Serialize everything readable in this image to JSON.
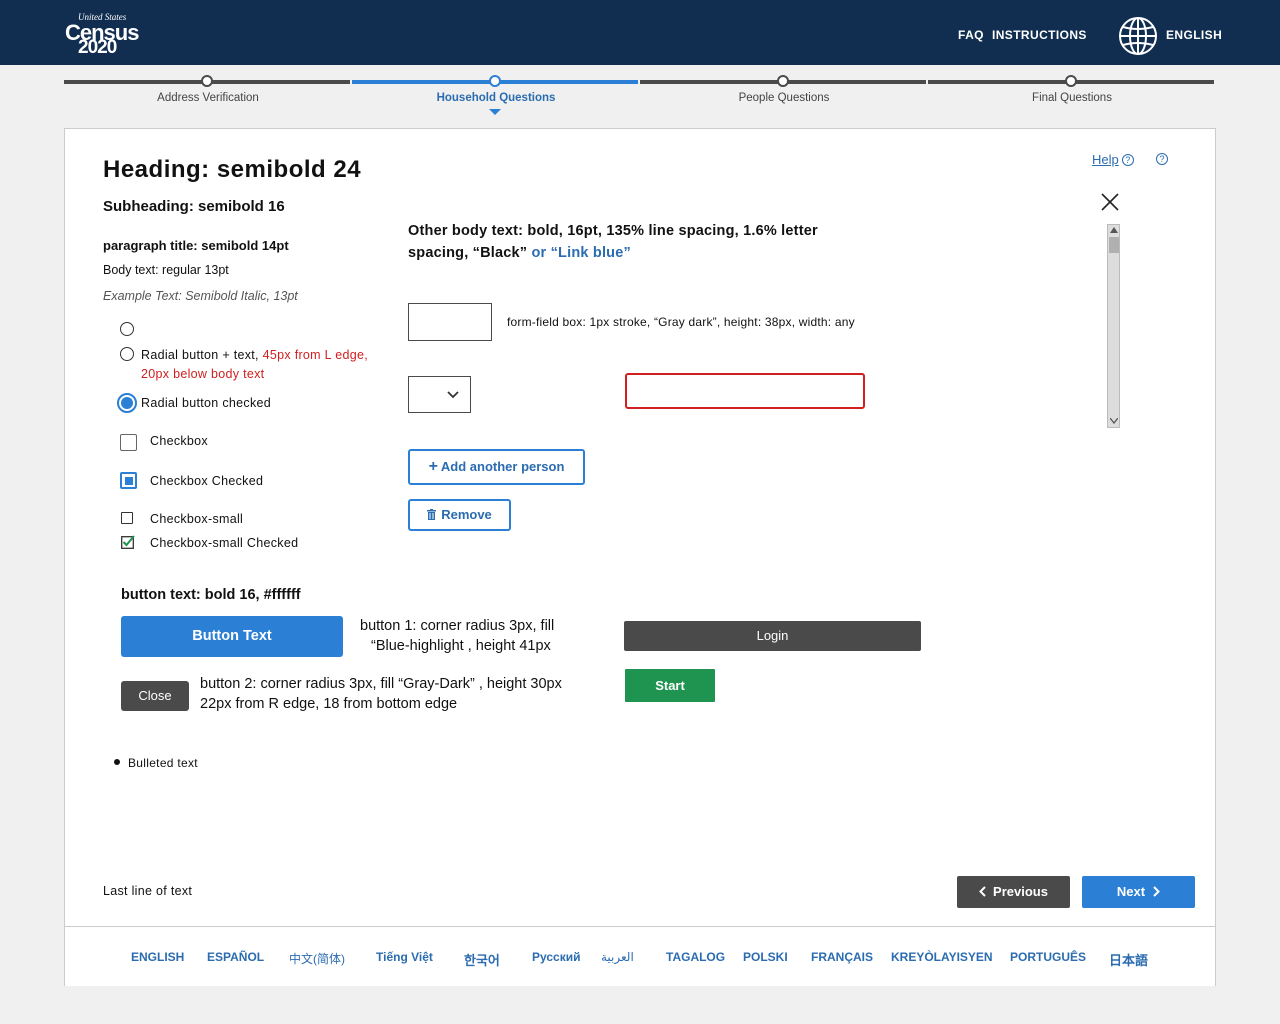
{
  "header": {
    "logo": {
      "line1": "United States",
      "line2": "Census",
      "line3": "2020"
    },
    "faq": "FAQ",
    "instructions": "INSTRUCTIONS",
    "language": "ENGLISH"
  },
  "progress": {
    "steps": [
      {
        "label": "Address Verification"
      },
      {
        "label": "Household Questions"
      },
      {
        "label": "People  Questions"
      },
      {
        "label": "Final Questions"
      }
    ],
    "active_index": 1
  },
  "content": {
    "heading": "Heading: semibold 24",
    "subheading": "Subheading: semibold 16",
    "paragraph_title": "paragraph title: semibold 14pt",
    "body_text": "Body text: regular 13pt",
    "example_text": "Example Text: Semibold Italic, 13pt",
    "help": "Help",
    "radio_label_a": "Radial button + text, ",
    "radio_label_red1": "45px from L edge,",
    "radio_label_red2": "20px below body text",
    "radio_checked_label": "Radial button checked",
    "checkbox_label": "Checkbox",
    "checkbox_checked_label": "Checkbox Checked",
    "checkbox_small_label": "Checkbox-small",
    "checkbox_small_checked_label": "Checkbox-small Checked",
    "other_body_black": "Other body text: bold, 16pt, 135% line spacing, 1.6% letter spacing, “Black”",
    "other_body_link": " or “Link blue”",
    "form_field_desc": "form-field box: 1px stroke, “Gray dark”, height: 38px, width: any",
    "add_person": "Add another person",
    "remove": "Remove",
    "button_text_title": "button text: bold 16, #ffffff",
    "button_text": "Button Text",
    "button1_desc_line1": "button 1: corner radius 3px, fill",
    "button1_desc_line2": "“Blue-highlight , height 41px",
    "close": "Close",
    "button2_desc_line1": "button 2: corner radius 3px, fill “Gray-Dark” , height 30px",
    "button2_desc_line2": "22px from R edge, 18 from bottom edge",
    "login": "Login",
    "start": "Start",
    "bulleted": "Bulleted text",
    "last_line": "Last line of text",
    "previous": "Previous",
    "next": "Next"
  },
  "footer": {
    "languages": [
      "ENGLISH",
      "ESPAÑOL",
      "中文(简体)",
      "Tiếng Việt",
      "한국어",
      "Русский",
      "العربية",
      "TAGALOG",
      "POLSKI",
      "FRANÇAIS",
      "KREYÒLAYISYEN",
      "PORTUGUÊS",
      "日本語"
    ]
  },
  "colors": {
    "navy": "#112e51",
    "blue_highlight": "#2b7fd4",
    "link_blue": "#2b6cb0",
    "gray_dark": "#4a4a4a",
    "error_red": "#d01f1f",
    "start_green": "#1f9450"
  }
}
